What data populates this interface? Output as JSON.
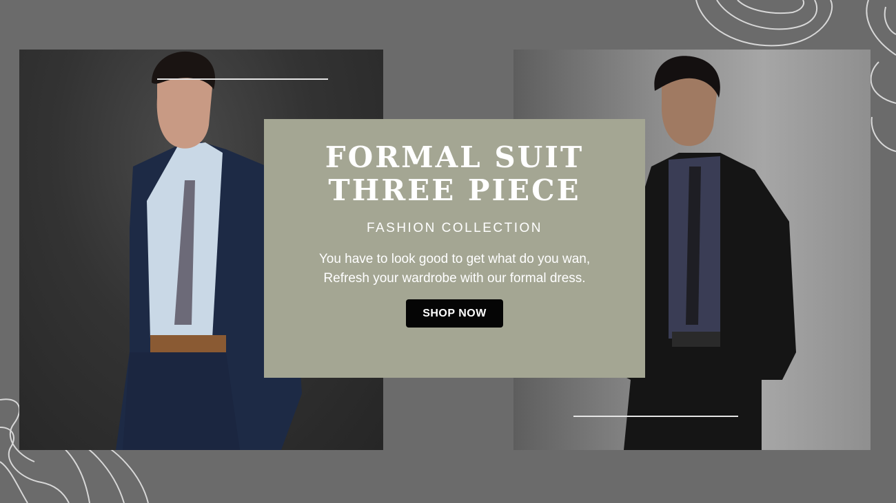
{
  "hero": {
    "title": "FORMAL SUIT THREE PIECE",
    "subtitle": "FASHION COLLECTION",
    "description": "You have to look good to get what do you wan, Refresh your wardrobe with our formal dress.",
    "cta_label": "SHOP NOW"
  },
  "colors": {
    "background": "#6b6b6b",
    "card": "#a4a693",
    "button": "#050505",
    "text": "#ffffff"
  }
}
